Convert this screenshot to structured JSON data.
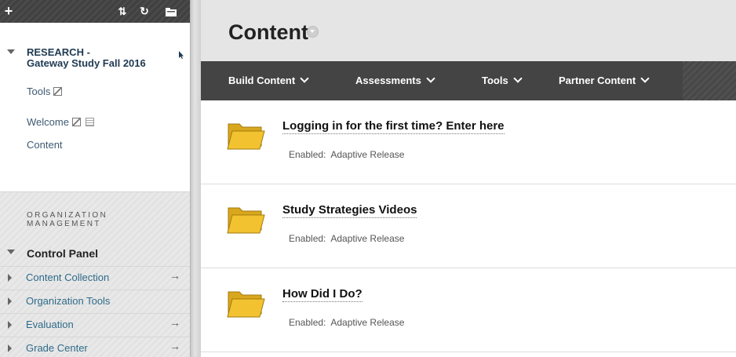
{
  "toolbar": {
    "add_glyph": "+",
    "sort_glyph": "⇅",
    "refresh_glyph": "↻",
    "folder_icon": "folder-icon"
  },
  "course": {
    "title_line1": "RESEARCH -",
    "title_line2": "Gateway Study Fall 2016",
    "menu": [
      {
        "label": "Tools"
      },
      {
        "label": "Welcome"
      },
      {
        "label": "Content"
      }
    ]
  },
  "org": {
    "heading_line1": "ORGANIZATION",
    "heading_line2": "MANAGEMENT",
    "control_panel": "Control Panel",
    "items": [
      {
        "label": "Content Collection",
        "arrow": "→"
      },
      {
        "label": "Organization Tools",
        "arrow": ""
      },
      {
        "label": "Evaluation",
        "arrow": "→"
      },
      {
        "label": "Grade Center",
        "arrow": "→"
      }
    ]
  },
  "page": {
    "title": "Content"
  },
  "actions": [
    {
      "label": "Build Content"
    },
    {
      "label": "Assessments"
    },
    {
      "label": "Tools"
    },
    {
      "label": "Partner Content"
    }
  ],
  "items": [
    {
      "title": "Logging in for the first time? Enter here",
      "meta_label": "Enabled:",
      "meta_value": "Adaptive Release"
    },
    {
      "title": "Study Strategies Videos",
      "meta_label": "Enabled:",
      "meta_value": "Adaptive Release"
    },
    {
      "title": "How Did I Do?",
      "meta_label": "Enabled:",
      "meta_value": "Adaptive Release"
    }
  ],
  "colors": {
    "action_bar": "#444444",
    "sidebar_link": "#3d5a73",
    "control_panel_link": "#2e6b8a",
    "folder": "#f2c230"
  }
}
